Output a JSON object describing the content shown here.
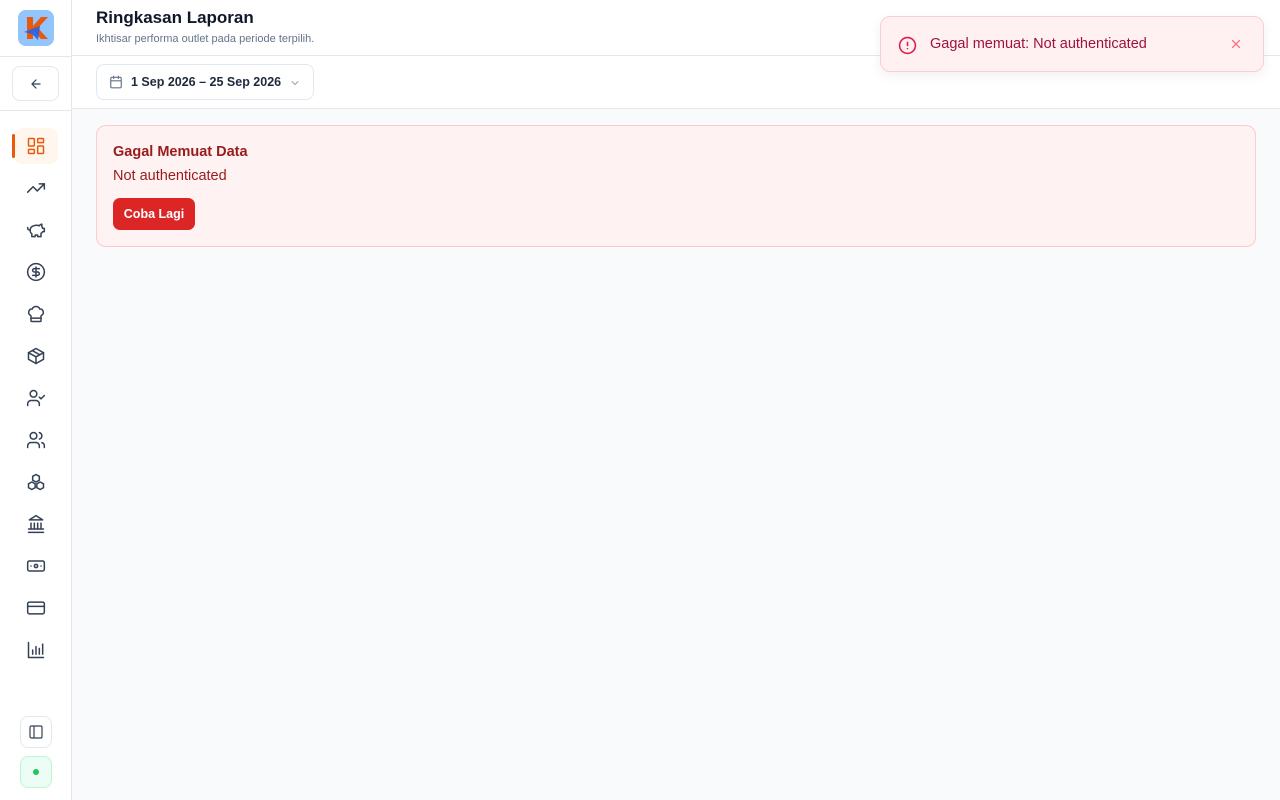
{
  "header": {
    "title": "Ringkasan Laporan",
    "subtitle": "Ikhtisar performa outlet pada periode terpilih."
  },
  "toolbar": {
    "date_range": "1 Sep 2026 – 25 Sep 2026"
  },
  "error_card": {
    "title": "Gagal Memuat Data",
    "message": "Not authenticated",
    "retry_label": "Coba Lagi"
  },
  "toast": {
    "message": "Gagal memuat: Not authenticated"
  },
  "sidebar": {
    "active_index": 0,
    "items": [
      {
        "icon": "dashboard-icon"
      },
      {
        "icon": "trending-up-icon"
      },
      {
        "icon": "piggy-bank-icon"
      },
      {
        "icon": "dollar-circle-icon"
      },
      {
        "icon": "chef-hat-icon"
      },
      {
        "icon": "package-icon"
      },
      {
        "icon": "user-check-icon"
      },
      {
        "icon": "users-icon"
      },
      {
        "icon": "boxes-icon"
      },
      {
        "icon": "bank-icon"
      },
      {
        "icon": "banknote-icon"
      },
      {
        "icon": "credit-card-icon"
      },
      {
        "icon": "bar-chart-icon"
      }
    ]
  },
  "colors": {
    "accent": "#ea580c",
    "error_text": "#991b1b",
    "error_bg": "#fef2f2",
    "retry_button": "#dc2626",
    "toast_text": "#9f1239",
    "icon": "#334155"
  }
}
